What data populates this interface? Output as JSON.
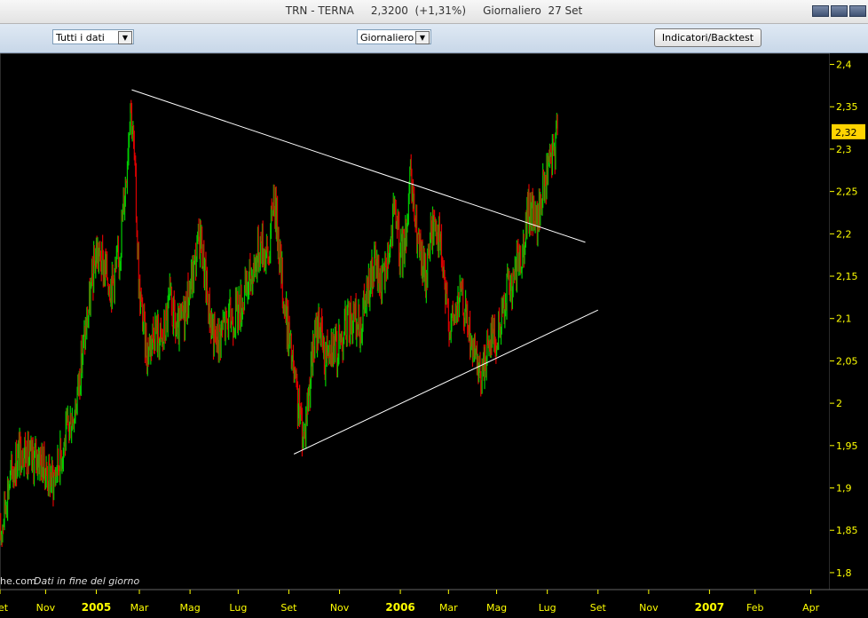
{
  "window": {
    "title": "TRN - TERNA     2,3200  (+1,31%)     Giornaliero  27 Set"
  },
  "toolbar": {
    "range_select": "Tutti i dati",
    "period_select": "Giornaliero",
    "indicators_button": "Indicatori/Backtest"
  },
  "chart_data": {
    "type": "candlestick",
    "title": "",
    "xlabel": "",
    "ylabel": "",
    "ylim": [
      1.78,
      2.41
    ],
    "y_ticks": [
      "2,4",
      "2,35",
      "2,3",
      "2,25",
      "2,2",
      "2,15",
      "2,1",
      "2,05",
      "2",
      "1,95",
      "1,9",
      "1,85",
      "1,8"
    ],
    "x_ticks": [
      {
        "label": "Set",
        "bold": false
      },
      {
        "label": "Nov",
        "bold": false
      },
      {
        "label": "2005",
        "bold": true
      },
      {
        "label": "Mar",
        "bold": false
      },
      {
        "label": "Mag",
        "bold": false
      },
      {
        "label": "Lug",
        "bold": false
      },
      {
        "label": "Set",
        "bold": false
      },
      {
        "label": "Nov",
        "bold": false
      },
      {
        "label": "2006",
        "bold": true
      },
      {
        "label": "Mar",
        "bold": false
      },
      {
        "label": "Mag",
        "bold": false
      },
      {
        "label": "Lug",
        "bold": false
      },
      {
        "label": "Set",
        "bold": false
      },
      {
        "label": "Nov",
        "bold": false
      },
      {
        "label": "2007",
        "bold": true
      },
      {
        "label": "Feb",
        "bold": false
      },
      {
        "label": "Apr",
        "bold": false
      }
    ],
    "last_price_label": "2,32",
    "last_price": 2.32,
    "up_color": "#00cc00",
    "down_color": "#dd0000",
    "background": "#000000",
    "axis_text_color": "#ffff00",
    "price_path": [
      {
        "t": 0,
        "v": 1.84
      },
      {
        "t": 6,
        "v": 1.9
      },
      {
        "t": 12,
        "v": 1.93
      },
      {
        "t": 18,
        "v": 1.95
      },
      {
        "t": 24,
        "v": 1.93
      },
      {
        "t": 30,
        "v": 1.94
      },
      {
        "t": 36,
        "v": 1.92
      },
      {
        "t": 42,
        "v": 1.91
      },
      {
        "t": 48,
        "v": 1.94
      },
      {
        "t": 54,
        "v": 1.97
      },
      {
        "t": 60,
        "v": 2.0
      },
      {
        "t": 66,
        "v": 2.07
      },
      {
        "t": 70,
        "v": 2.11
      },
      {
        "t": 76,
        "v": 2.18
      },
      {
        "t": 82,
        "v": 2.16
      },
      {
        "t": 88,
        "v": 2.14
      },
      {
        "t": 94,
        "v": 2.17
      },
      {
        "t": 100,
        "v": 2.28
      },
      {
        "t": 103,
        "v": 2.36
      },
      {
        "t": 106,
        "v": 2.29
      },
      {
        "t": 110,
        "v": 2.13
      },
      {
        "t": 116,
        "v": 2.06
      },
      {
        "t": 122,
        "v": 2.09
      },
      {
        "t": 128,
        "v": 2.07
      },
      {
        "t": 134,
        "v": 2.12
      },
      {
        "t": 140,
        "v": 2.08
      },
      {
        "t": 146,
        "v": 2.11
      },
      {
        "t": 152,
        "v": 2.15
      },
      {
        "t": 158,
        "v": 2.2
      },
      {
        "t": 164,
        "v": 2.12
      },
      {
        "t": 170,
        "v": 2.07
      },
      {
        "t": 176,
        "v": 2.09
      },
      {
        "t": 182,
        "v": 2.1
      },
      {
        "t": 188,
        "v": 2.11
      },
      {
        "t": 194,
        "v": 2.13
      },
      {
        "t": 200,
        "v": 2.16
      },
      {
        "t": 206,
        "v": 2.19
      },
      {
        "t": 212,
        "v": 2.17
      },
      {
        "t": 216,
        "v": 2.25
      },
      {
        "t": 220,
        "v": 2.19
      },
      {
        "t": 224,
        "v": 2.12
      },
      {
        "t": 228,
        "v": 2.08
      },
      {
        "t": 232,
        "v": 2.03
      },
      {
        "t": 236,
        "v": 1.99
      },
      {
        "t": 240,
        "v": 1.96
      },
      {
        "t": 244,
        "v": 2.02
      },
      {
        "t": 248,
        "v": 2.07
      },
      {
        "t": 252,
        "v": 2.1
      },
      {
        "t": 256,
        "v": 2.05
      },
      {
        "t": 260,
        "v": 2.08
      },
      {
        "t": 266,
        "v": 2.06
      },
      {
        "t": 272,
        "v": 2.09
      },
      {
        "t": 278,
        "v": 2.1
      },
      {
        "t": 284,
        "v": 2.09
      },
      {
        "t": 290,
        "v": 2.13
      },
      {
        "t": 296,
        "v": 2.16
      },
      {
        "t": 302,
        "v": 2.14
      },
      {
        "t": 308,
        "v": 2.19
      },
      {
        "t": 312,
        "v": 2.23
      },
      {
        "t": 316,
        "v": 2.17
      },
      {
        "t": 320,
        "v": 2.2
      },
      {
        "t": 324,
        "v": 2.26
      },
      {
        "t": 328,
        "v": 2.21
      },
      {
        "t": 332,
        "v": 2.17
      },
      {
        "t": 336,
        "v": 2.15
      },
      {
        "t": 340,
        "v": 2.2
      },
      {
        "t": 344,
        "v": 2.22
      },
      {
        "t": 348,
        "v": 2.18
      },
      {
        "t": 352,
        "v": 2.12
      },
      {
        "t": 356,
        "v": 2.09
      },
      {
        "t": 360,
        "v": 2.11
      },
      {
        "t": 364,
        "v": 2.13
      },
      {
        "t": 368,
        "v": 2.1
      },
      {
        "t": 372,
        "v": 2.07
      },
      {
        "t": 376,
        "v": 2.04
      },
      {
        "t": 380,
        "v": 2.03
      },
      {
        "t": 384,
        "v": 2.06
      },
      {
        "t": 388,
        "v": 2.09
      },
      {
        "t": 392,
        "v": 2.07
      },
      {
        "t": 396,
        "v": 2.1
      },
      {
        "t": 400,
        "v": 2.14
      },
      {
        "t": 404,
        "v": 2.13
      },
      {
        "t": 408,
        "v": 2.16
      },
      {
        "t": 412,
        "v": 2.18
      },
      {
        "t": 416,
        "v": 2.22
      },
      {
        "t": 420,
        "v": 2.23
      },
      {
        "t": 424,
        "v": 2.21
      },
      {
        "t": 428,
        "v": 2.25
      },
      {
        "t": 432,
        "v": 2.27
      },
      {
        "t": 436,
        "v": 2.29
      },
      {
        "t": 440,
        "v": 2.32
      }
    ],
    "trendlines": [
      {
        "t1": 104,
        "v1": 2.37,
        "t2": 462,
        "v2": 2.19
      },
      {
        "t1": 232,
        "v1": 1.94,
        "t2": 472,
        "v2": 2.11
      }
    ],
    "time_ticks": [
      0,
      36,
      76,
      110,
      150,
      188,
      228,
      268,
      316,
      354,
      392,
      432,
      472,
      512,
      560,
      596,
      640
    ],
    "time_range": [
      0,
      655
    ]
  },
  "footer": {
    "site_fragment": "he.com",
    "note": "Dati in fine del giorno"
  }
}
